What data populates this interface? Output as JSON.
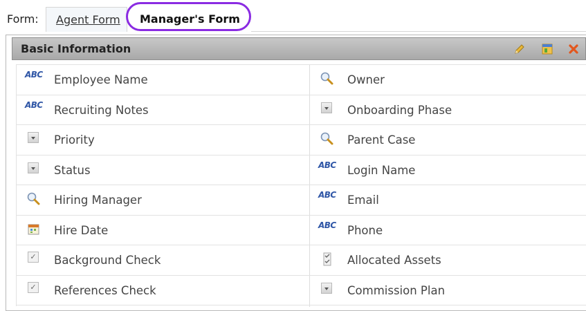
{
  "tabs": {
    "form_label": "Form:",
    "items": [
      {
        "label": "Agent Form",
        "active": false
      },
      {
        "label": "Manager's Form",
        "active": true
      }
    ]
  },
  "panel": {
    "title": "Basic Information",
    "header_icons": [
      "edit-pencil-icon",
      "layout-icon",
      "close-x-icon"
    ]
  },
  "fields": {
    "left": [
      {
        "label": "Employee Name",
        "type": "text",
        "icon": "abc-text-icon"
      },
      {
        "label": "Recruiting Notes",
        "type": "text",
        "icon": "abc-text-icon"
      },
      {
        "label": "Priority",
        "type": "picklist",
        "icon": "dropdown-icon"
      },
      {
        "label": "Status",
        "type": "picklist",
        "icon": "dropdown-icon"
      },
      {
        "label": "Hiring Manager",
        "type": "lookup",
        "icon": "magnifier-icon"
      },
      {
        "label": "Hire Date",
        "type": "date",
        "icon": "calendar-icon"
      },
      {
        "label": "Background Check",
        "type": "checkbox",
        "icon": "checkbox-icon"
      },
      {
        "label": "References Check",
        "type": "checkbox",
        "icon": "checkbox-icon"
      }
    ],
    "right": [
      {
        "label": "Owner",
        "type": "lookup",
        "icon": "magnifier-icon"
      },
      {
        "label": "Onboarding Phase",
        "type": "picklist",
        "icon": "dropdown-icon"
      },
      {
        "label": "Parent Case",
        "type": "lookup",
        "icon": "magnifier-icon"
      },
      {
        "label": "Login Name",
        "type": "text",
        "icon": "abc-text-icon"
      },
      {
        "label": "Email",
        "type": "text",
        "icon": "abc-text-icon"
      },
      {
        "label": "Phone",
        "type": "text",
        "icon": "abc-text-icon"
      },
      {
        "label": "Allocated Assets",
        "type": "multiselect",
        "icon": "multi-checkbox-icon"
      },
      {
        "label": "Commission Plan",
        "type": "picklist",
        "icon": "dropdown-icon"
      }
    ]
  },
  "icon_glyphs": {
    "abc": "ABC",
    "checkbox": "✓"
  },
  "colors": {
    "highlight_circle": "#8a2be2",
    "abc_blue": "#2f56a6",
    "header_gray": "#b0b0b0"
  }
}
